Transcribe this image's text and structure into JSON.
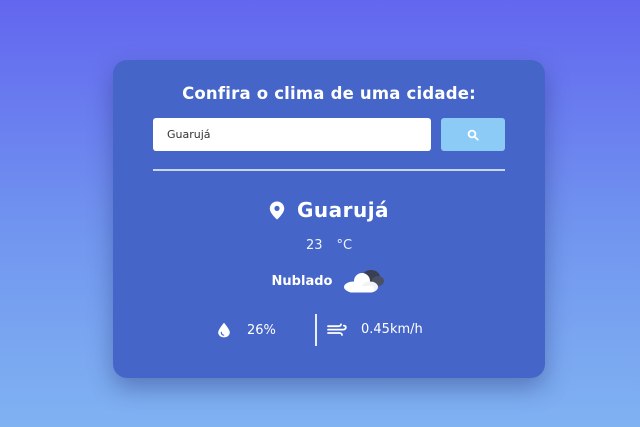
{
  "title": "Confira o clima de uma cidade:",
  "search": {
    "value": "Guarujá",
    "button_icon": "search-icon"
  },
  "weather": {
    "city": "Guarujá",
    "city_icon": "map-pin-icon",
    "temperature": "23",
    "unit": "°C",
    "description": "Nublado",
    "description_icon": "cloud-icon",
    "humidity": "26%",
    "humidity_icon": "droplet-icon",
    "wind": "0.45km/h",
    "wind_icon": "wind-icon"
  },
  "colors": {
    "card": "#4566c8",
    "button": "#8ccbf6",
    "background_top": "#6366ef",
    "background_bottom": "#80b2f2"
  }
}
